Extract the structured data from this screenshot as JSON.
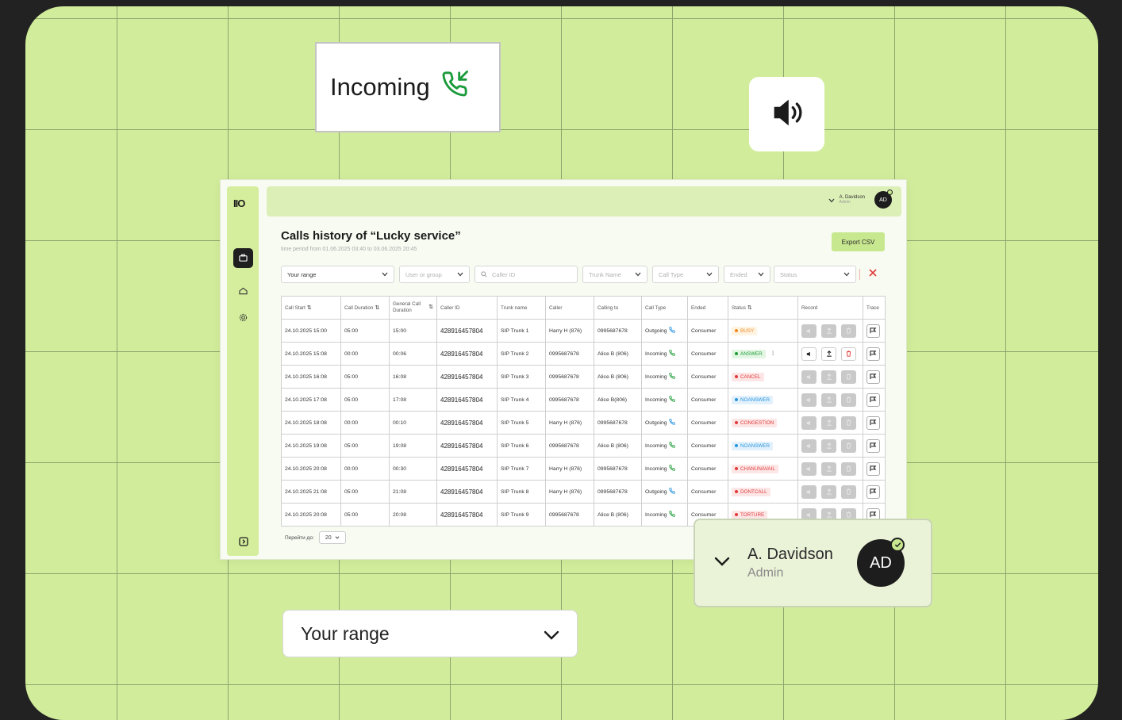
{
  "callout_incoming": {
    "label": "Incoming",
    "icon": "phone-incoming-icon",
    "color": "#1a9a3a"
  },
  "speaker_card": {
    "icon": "speaker-volume-icon"
  },
  "range_card": {
    "label": "Your range",
    "icon": "chevron-down-icon"
  },
  "user_card": {
    "name": "A. Davidson",
    "role": "Admin",
    "avatar": "AD"
  },
  "app": {
    "logo": "IIO",
    "sidebar": [
      {
        "name": "briefcase-icon",
        "active": true
      },
      {
        "name": "home-icon",
        "active": false
      },
      {
        "name": "gear-icon",
        "active": false
      },
      {
        "name": "collapse-icon",
        "active": false
      }
    ],
    "topbar": {
      "name": "A. Davidson",
      "role": "Admin",
      "avatar": "AD"
    },
    "title": "Calls history of “Lucky service”",
    "subtitle": "time period from 01.06.2025 03:40 to 03.06.2025 20:45",
    "export_label": "Export CSV",
    "filters": {
      "range": "Your range",
      "user_group": "User or group",
      "caller_id": "Caller ID",
      "trunk_name": "Trunk Name",
      "call_type": "Call Type",
      "ended": "Ended",
      "status": "Status"
    },
    "columns": {
      "call_start": "Call Start",
      "call_duration": "Call Duration",
      "general_duration_1": "General Call",
      "general_duration_2": "Duration",
      "caller_id": "Caller ID",
      "trunk_name": "Trunk name",
      "caller": "Caller",
      "calling_to": "Calling to",
      "call_type": "Call Type",
      "ended": "Ended",
      "status": "Status",
      "record": "Record",
      "trace": "Trace"
    },
    "rows": [
      {
        "start": "24.10.2025 15:00",
        "duration": "05:00",
        "general": "15:00",
        "caller_id": "428916457804",
        "trunk": "SIP Trunk 1",
        "caller": "Harry H (876)",
        "calling_to": "0995687678",
        "type": "Outgoing",
        "ended": "Consumer",
        "status": "BUSY",
        "status_color": "#f08a24",
        "status_bg": "#fff3e2",
        "record_active": false
      },
      {
        "start": "24.10.2025 15:08",
        "duration": "00:00",
        "general": "00:06",
        "caller_id": "428916457804",
        "trunk": "SIP Trunk 2",
        "caller": "0995687678",
        "calling_to": "Alice B (806)",
        "type": "Incoming",
        "ended": "Consumer",
        "status": "ANSWER",
        "status_color": "#1f9d3a",
        "status_bg": "#e3f6e3",
        "record_active": true
      },
      {
        "start": "24.10.2025 16:08",
        "duration": "05:00",
        "general": "16:08",
        "caller_id": "428916457804",
        "trunk": "SIP Trunk 3",
        "caller": "0995687678",
        "calling_to": "Alice B (806)",
        "type": "Incoming",
        "ended": "Consumer",
        "status": "CANCEL",
        "status_color": "#e23b3b",
        "status_bg": "#fde6e6",
        "record_active": false
      },
      {
        "start": "24.10.2025 17:08",
        "duration": "05:00",
        "general": "17:08",
        "caller_id": "428916457804",
        "trunk": "SIP Trunk 4",
        "caller": "0995687678",
        "calling_to": "Alice B(806)",
        "type": "Incoming",
        "ended": "Consumer",
        "status": "NOANSWER",
        "status_color": "#2a95e0",
        "status_bg": "#e2f1fc",
        "record_active": false
      },
      {
        "start": "24.10.2025 18:08",
        "duration": "00:00",
        "general": "00:10",
        "caller_id": "428916457804",
        "trunk": "SIP Trunk 5",
        "caller": "Harry H (876)",
        "calling_to": "0995687678",
        "type": "Outgoing",
        "ended": "Consumer",
        "status": "CONGESTION",
        "status_color": "#e23b3b",
        "status_bg": "#fde6e6",
        "record_active": false
      },
      {
        "start": "24.10.2025 19:08",
        "duration": "05:00",
        "general": "19:08",
        "caller_id": "428916457804",
        "trunk": "SIP Trunk 6",
        "caller": "0995687678",
        "calling_to": "Alice B (806)",
        "type": "Incoming",
        "ended": "Consumer",
        "status": "NOANSWER",
        "status_color": "#2a95e0",
        "status_bg": "#e2f1fc",
        "record_active": false
      },
      {
        "start": "24.10.2025 20:08",
        "duration": "00:00",
        "general": "00:30",
        "caller_id": "428916457804",
        "trunk": "SIP Trunk 7",
        "caller": "Harry H (876)",
        "calling_to": "0995687678",
        "type": "Incoming",
        "ended": "Consumer",
        "status": "CHANUNAVAIL",
        "status_color": "#e23b3b",
        "status_bg": "#fde6e6",
        "record_active": false
      },
      {
        "start": "24.10.2025 21:08",
        "duration": "05:00",
        "general": "21:08",
        "caller_id": "428916457804",
        "trunk": "SIP Trunk 8",
        "caller": "Harry H (876)",
        "calling_to": "0995687678",
        "type": "Outgoing",
        "ended": "Consumer",
        "status": "DONTCALL",
        "status_color": "#e23b3b",
        "status_bg": "#fde6e6",
        "record_active": false
      },
      {
        "start": "24.10.2025 20:08",
        "duration": "05:00",
        "general": "20:08",
        "caller_id": "428916457804",
        "trunk": "SIP Trunk 9",
        "caller": "0995687678",
        "calling_to": "Alice B (806)",
        "type": "Incoming",
        "ended": "Consumer",
        "status": "TORTURE",
        "status_color": "#e23b3b",
        "status_bg": "#fde6e6",
        "record_active": false
      }
    ],
    "pager": {
      "label": "Перейти до:",
      "value": "20"
    },
    "colors": {
      "accent": "#c8e890",
      "incoming": "#1f9d3a",
      "outgoing": "#2a95e0"
    }
  }
}
